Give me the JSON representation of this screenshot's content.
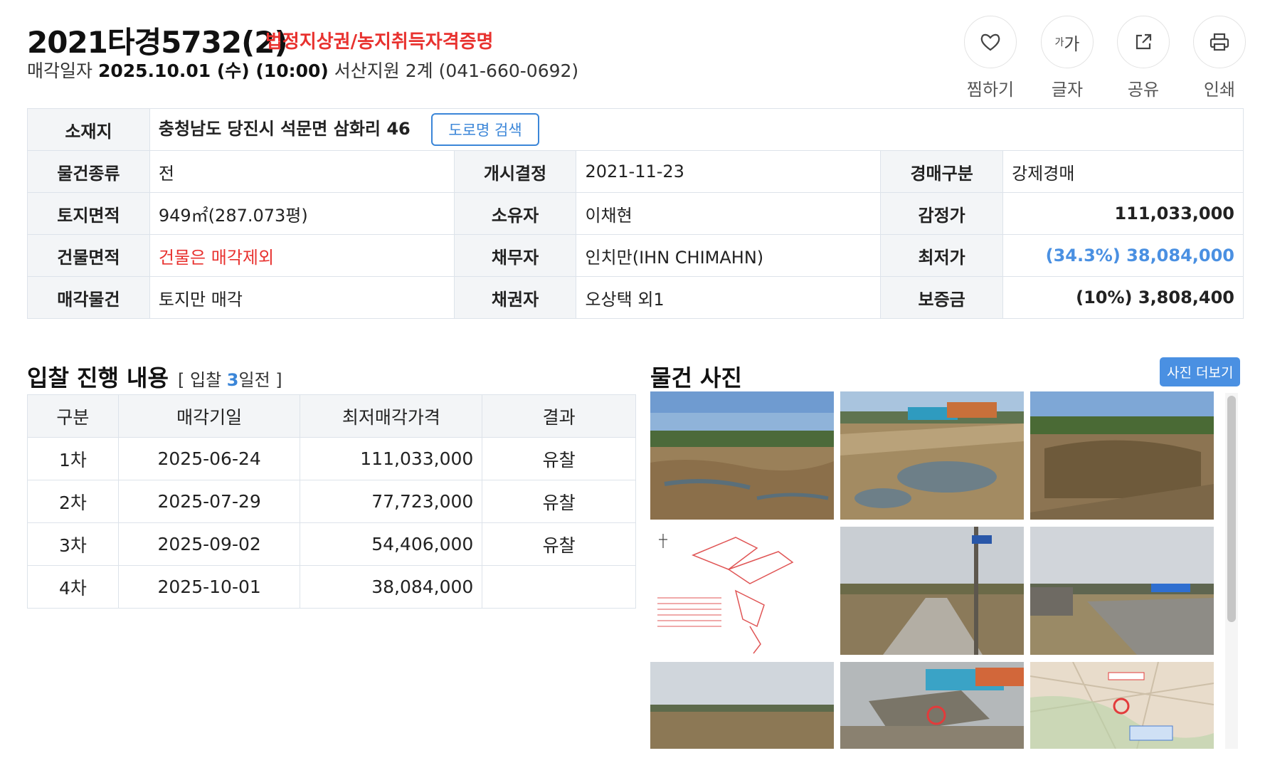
{
  "header": {
    "case_number": "2021타경5732(2)",
    "tags": "법정지상권/농지취득자격증명",
    "sale_label": "매각일자",
    "sale_date": "2025.10.01 (수) (10:00)",
    "court": "서산지원 2계 (041-660-0692)"
  },
  "toolbar": {
    "bookmark": "찜하기",
    "font": "글자",
    "font_icon": "가가",
    "share": "공유",
    "print": "인쇄"
  },
  "info": {
    "location_label": "소재지",
    "location": "충청남도 당진시 석문면 삼화리 46",
    "road_search": "도로명 검색",
    "rows": [
      {
        "l1": "물건종류",
        "v1": "전",
        "l2": "개시결정",
        "v2": "2021-11-23",
        "l3": "경매구분",
        "v3": "강제경매"
      },
      {
        "l1": "토지면적",
        "v1": "949㎡(287.073평)",
        "l2": "소유자",
        "v2": "이채현",
        "l3": "감정가",
        "v3": "111,033,000"
      },
      {
        "l1": "건물면적",
        "v1": "건물은 매각제외",
        "l2": "채무자",
        "v2": "인치만(IHN CHIMAHN)",
        "l3": "최저가",
        "v3": "(34.3%) 38,084,000"
      },
      {
        "l1": "매각물건",
        "v1": "토지만 매각",
        "l2": "채권자",
        "v2": "오상택 외1",
        "l3": "보증금",
        "v3": "(10%) 3,808,400"
      }
    ]
  },
  "bid": {
    "title": "입찰 진행 내용",
    "sub_prefix": "[ 입찰 ",
    "sub_days": "3",
    "sub_suffix": "일전 ]",
    "headers": [
      "구분",
      "매각기일",
      "최저매각가격",
      "결과"
    ],
    "rows": [
      [
        "1차",
        "2025-06-24",
        "111,033,000",
        "유찰"
      ],
      [
        "2차",
        "2025-07-29",
        "77,723,000",
        "유찰"
      ],
      [
        "3차",
        "2025-09-02",
        "54,406,000",
        "유찰"
      ],
      [
        "4차",
        "2025-10-01",
        "38,084,000",
        ""
      ]
    ]
  },
  "photos": {
    "title": "물건 사진",
    "more": "사진 더보기"
  },
  "colors": {
    "accent_red": "#e8322f",
    "accent_blue": "#4a90e2"
  }
}
